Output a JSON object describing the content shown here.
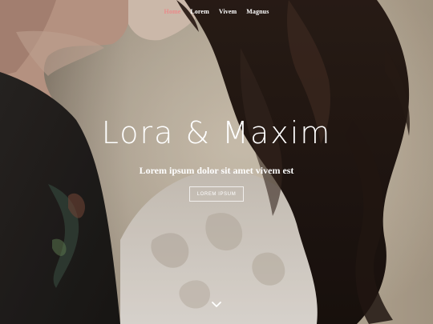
{
  "nav": {
    "items": [
      {
        "label": "Home",
        "active": true
      },
      {
        "label": "Lorem",
        "active": false
      },
      {
        "label": "Vivem",
        "active": false
      },
      {
        "label": "Magnus",
        "active": false
      }
    ]
  },
  "hero": {
    "title": "Lora & Maxim",
    "subtitle": "Lorem ipsum dolor sit amet vivem est",
    "cta_label": "LOREM IPSUM",
    "scroll_icon": "chevron-down-icon"
  },
  "colors": {
    "active_nav": "#e98b8b",
    "text": "#ffffff"
  }
}
